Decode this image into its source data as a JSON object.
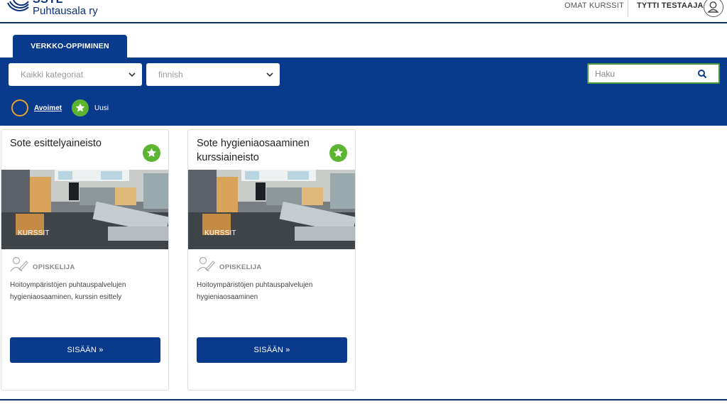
{
  "header": {
    "logo_top": "SSTL",
    "logo_bottom": "Puhtausala ry",
    "my_courses": "OMAT KURSSIT",
    "user_name": "TYTTI TESTAAJA",
    "user_icon": "user-icon"
  },
  "tab": {
    "label": "VERKKO-OPPIMINEN"
  },
  "filters": {
    "category": "Kaikki kategoriat",
    "language": "finnish",
    "search_placeholder": "Haku",
    "search_icon": "search-icon"
  },
  "legend": {
    "open_label": "Avoimet",
    "new_label": "Uusi",
    "open_color": "#e4a02a",
    "new_color": "#5cb531"
  },
  "colors": {
    "brand": "#0a3a8c",
    "accent_green": "#5cb531"
  },
  "courses": [
    {
      "title": "Sote esittelyaineisto",
      "badge_icon": "star-icon",
      "image_label": "KURSSIT",
      "role": "OPISKELIJA",
      "description": "Hoitoympäristöjen puhtauspalvelujen hygieniaosaaminen, kurssin esittely",
      "button": "SISÄÄN »"
    },
    {
      "title": "Sote hygieniaosaaminen kurssiaineisto",
      "badge_icon": "star-icon",
      "image_label": "KURSSIT",
      "role": "OPISKELIJA",
      "description": "Hoitoympäristöjen puhtauspalvelujen hygieniaosaaminen",
      "button": "SISÄÄN »"
    }
  ]
}
